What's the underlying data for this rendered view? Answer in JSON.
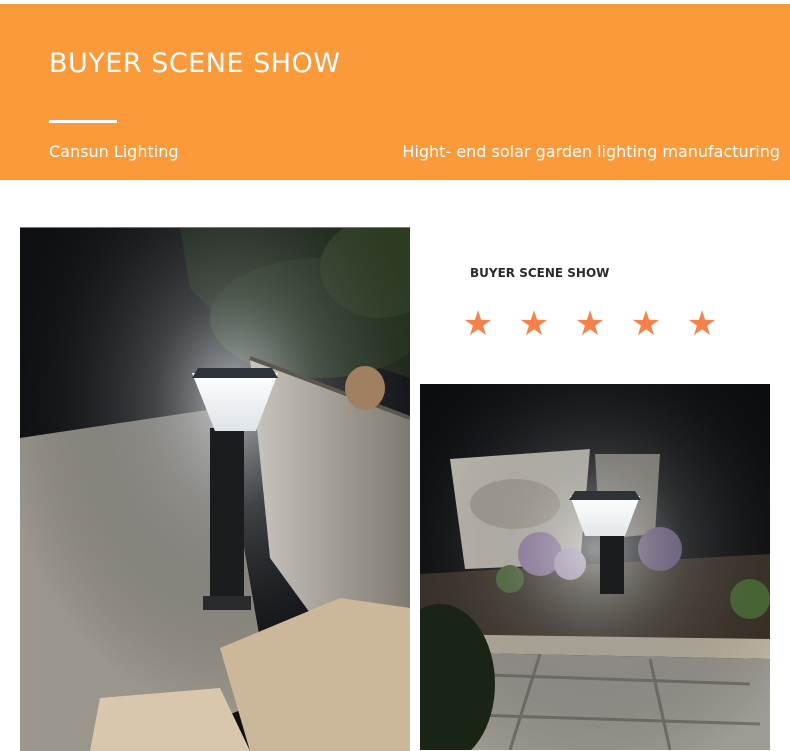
{
  "banner": {
    "title": "BUYER SCENE SHOW",
    "brand": "Cansun Lighting",
    "tagline": "Hight- end solar garden lighting manufacturing",
    "background_color": "#fb9a3b"
  },
  "showcase": {
    "title": "BUYER SCENE SHOW",
    "rating": 5,
    "star_color": "#f5824a",
    "star_glyph": "★"
  },
  "photos": [
    {
      "name": "solar-bollard-light-walkway-photo"
    },
    {
      "name": "solar-bollard-light-garden-bed-photo"
    }
  ]
}
